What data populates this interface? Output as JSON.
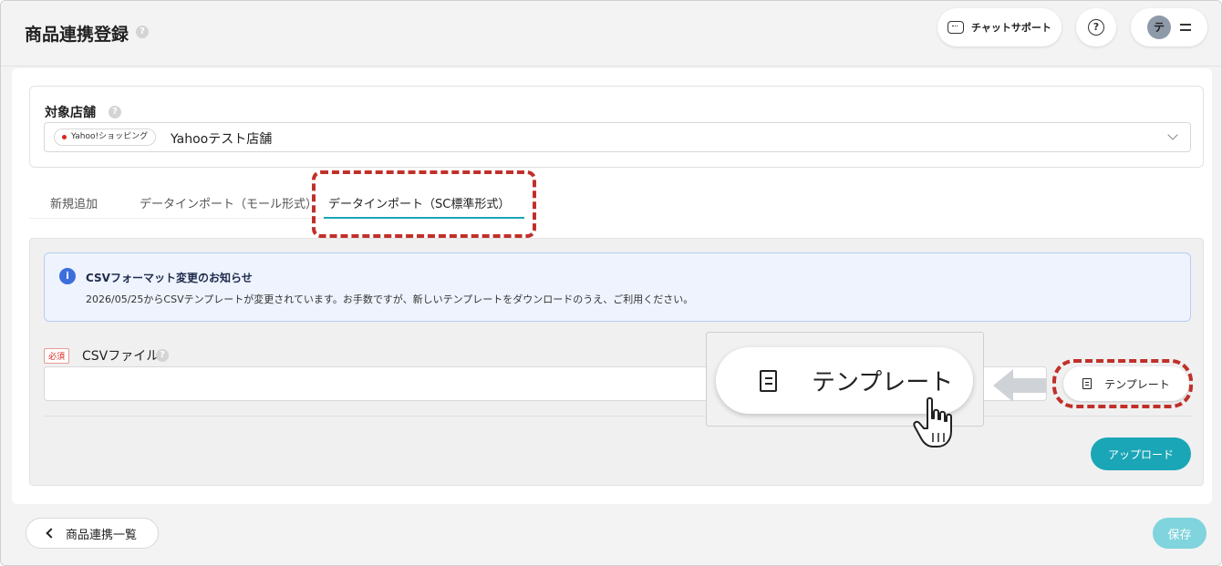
{
  "header": {
    "title": "商品連携登録",
    "chat_support_label": "チャットサポート",
    "help_symbol": "?",
    "avatar_initial": "テ"
  },
  "store": {
    "label": "対象店舗",
    "mall_badge": "Yahoo!ショッピング",
    "store_name": "Yahooテスト店舗"
  },
  "tabs": [
    {
      "label": "新規追加"
    },
    {
      "label": "データインポート（モール形式）"
    },
    {
      "label": "データインポート（SC標準形式）"
    }
  ],
  "notice": {
    "title": "CSVフォーマット変更のお知らせ",
    "body": "2026/05/25からCSVテンプレートが変更されています。お手数ですが、新しいテンプレートをダウンロードのうえ、ご利用ください。"
  },
  "csv": {
    "required_badge": "必須",
    "label": "CSVファイル",
    "value": ""
  },
  "buttons": {
    "template_label": "テンプレート",
    "upload_label": "アップロード",
    "back_label": "商品連携一覧",
    "save_label": "保存"
  },
  "zoom": {
    "template_label": "テンプレート"
  },
  "colors": {
    "accent": "#1aa6b7",
    "annotation": "#c0302a",
    "info": "#3d6fdc"
  }
}
